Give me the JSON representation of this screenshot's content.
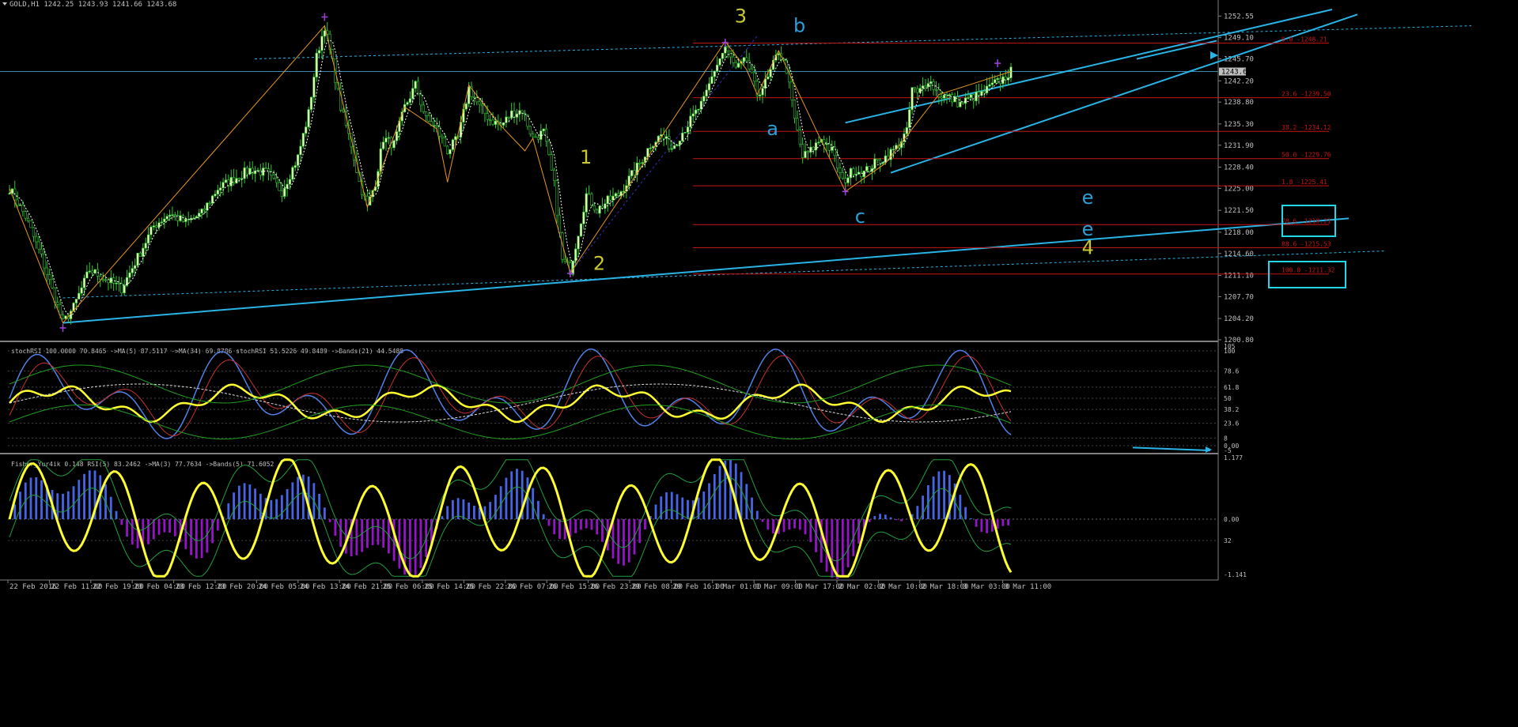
{
  "symbol_header": {
    "symbol": "GOLD,H1",
    "ohlc": "1242.25 1243.93 1241.66 1243.68"
  },
  "chart_data": [
    {
      "type": "candlestick",
      "title": "GOLD,H1",
      "price_axis_ticks": [
        1252.55,
        1249.1,
        1245.7,
        1242.2,
        1238.8,
        1235.3,
        1231.9,
        1228.4,
        1225.0,
        1221.5,
        1218.0,
        1214.6,
        1211.1,
        1207.7,
        1204.2,
        1200.8
      ],
      "ylim": [
        1200.8,
        1253.6
      ],
      "current_price": 1243.68,
      "time_labels": [
        "22 Feb 2016",
        "22 Feb 11:00",
        "22 Feb 19:00",
        "23 Feb 04:00",
        "23 Feb 12:00",
        "23 Feb 20:00",
        "24 Feb 05:00",
        "24 Feb 13:00",
        "24 Feb 21:00",
        "25 Feb 06:00",
        "25 Feb 14:00",
        "25 Feb 22:00",
        "26 Feb 07:00",
        "26 Feb 15:00",
        "26 Feb 23:00",
        "29 Feb 08:00",
        "29 Feb 16:00",
        "1 Mar 01:00",
        "1 Mar 09:00",
        "1 Mar 17:00",
        "2 Mar 02:00",
        "2 Mar 10:00",
        "2 Mar 18:00",
        "3 Mar 03:00",
        "3 Mar 11:00"
      ],
      "price_path": [
        [
          0,
          1225.0
        ],
        [
          6,
          1220.5
        ],
        [
          12,
          1214.0
        ],
        [
          17,
          1207.5
        ],
        [
          20,
          1203.5
        ],
        [
          24,
          1206.0
        ],
        [
          30,
          1212.0
        ],
        [
          36,
          1210.5
        ],
        [
          42,
          1209.0
        ],
        [
          48,
          1214.0
        ],
        [
          54,
          1219.0
        ],
        [
          60,
          1221.0
        ],
        [
          66,
          1219.5
        ],
        [
          72,
          1221.0
        ],
        [
          78,
          1225.0
        ],
        [
          84,
          1226.5
        ],
        [
          90,
          1228.0
        ],
        [
          96,
          1227.5
        ],
        [
          102,
          1224.5
        ],
        [
          108,
          1230.0
        ],
        [
          112,
          1237.0
        ],
        [
          115,
          1246.0
        ],
        [
          118,
          1251.0
        ],
        [
          121,
          1245.0
        ],
        [
          124,
          1238.0
        ],
        [
          128,
          1232.0
        ],
        [
          131,
          1226.0
        ],
        [
          134,
          1222.0
        ],
        [
          137,
          1226.0
        ],
        [
          140,
          1233.0
        ],
        [
          144,
          1232.0
        ],
        [
          148,
          1238.0
        ],
        [
          152,
          1241.5
        ],
        [
          156,
          1236.0
        ],
        [
          160,
          1234.5
        ],
        [
          164,
          1231.0
        ],
        [
          168,
          1233.0
        ],
        [
          172,
          1241.0
        ],
        [
          176,
          1238.0
        ],
        [
          180,
          1236.0
        ],
        [
          184,
          1235.0
        ],
        [
          188,
          1237.0
        ],
        [
          192,
          1237.5
        ],
        [
          196,
          1233.0
        ],
        [
          200,
          1234.0
        ],
        [
          204,
          1225.5
        ],
        [
          207,
          1213.5
        ],
        [
          210,
          1212.0
        ],
        [
          213,
          1218.0
        ],
        [
          216,
          1224.0
        ],
        [
          220,
          1221.5
        ],
        [
          224,
          1223.0
        ],
        [
          228,
          1224.0
        ],
        [
          232,
          1226.5
        ],
        [
          236,
          1229.0
        ],
        [
          240,
          1232.0
        ],
        [
          244,
          1233.5
        ],
        [
          248,
          1231.5
        ],
        [
          252,
          1234.0
        ],
        [
          256,
          1236.5
        ],
        [
          260,
          1239.0
        ],
        [
          264,
          1244.0
        ],
        [
          268,
          1247.5
        ],
        [
          272,
          1244.0
        ],
        [
          276,
          1245.5
        ],
        [
          280,
          1240.0
        ],
        [
          284,
          1242.5
        ],
        [
          288,
          1247.0
        ],
        [
          291,
          1244.0
        ],
        [
          294,
          1236.0
        ],
        [
          297,
          1230.0
        ],
        [
          300,
          1231.0
        ],
        [
          304,
          1233.0
        ],
        [
          308,
          1231.0
        ],
        [
          312,
          1226.0
        ],
        [
          316,
          1228.0
        ],
        [
          320,
          1227.5
        ],
        [
          324,
          1229.0
        ],
        [
          328,
          1230.0
        ],
        [
          332,
          1231.5
        ],
        [
          336,
          1234.0
        ],
        [
          338,
          1241.0
        ],
        [
          340,
          1240.0
        ],
        [
          344,
          1242.5
        ],
        [
          348,
          1240.0
        ],
        [
          352,
          1239.5
        ],
        [
          356,
          1238.5
        ],
        [
          360,
          1239.5
        ],
        [
          364,
          1240.0
        ],
        [
          368,
          1241.5
        ],
        [
          372,
          1242.5
        ],
        [
          375,
          1243.68
        ]
      ],
      "fibonacci_levels": [
        {
          "label": "0.0 -1248.21",
          "price": 1248.21
        },
        {
          "label": "23.6 -1239.50",
          "price": 1239.5
        },
        {
          "label": "38.2 -1234.12",
          "price": 1234.12
        },
        {
          "label": "50.0 -1229.76",
          "price": 1229.76
        },
        {
          "label": "1.8 -1225.41",
          "price": 1225.41
        },
        {
          "label": "78.6 -1219.21",
          "price": 1219.21
        },
        {
          "label": "88.6 -1215.53",
          "price": 1215.53
        },
        {
          "label": "100.0 -1211.32",
          "price": 1211.32
        }
      ],
      "wave_labels": [
        {
          "text": "1",
          "color": "#c8c832",
          "price": 1229.0,
          "bar": 210
        },
        {
          "text": "2",
          "color": "#c8c832",
          "price": 1212.0,
          "bar": 215
        },
        {
          "text": "3",
          "color": "#c8c832",
          "price": 1251.5,
          "bar": 268
        },
        {
          "text": "4",
          "color": "#c8c832",
          "price": 1214.5,
          "bar": 398
        },
        {
          "text": "a",
          "color": "#28a0dc",
          "price": 1233.5,
          "bar": 280
        },
        {
          "text": "b",
          "color": "#28a0dc",
          "price": 1250.0,
          "bar": 290
        },
        {
          "text": "c",
          "color": "#28a0dc",
          "price": 1219.5,
          "bar": 313
        },
        {
          "text": "e",
          "color": "#28a0dc",
          "price": 1222.5,
          "bar": 398
        },
        {
          "text": "e",
          "color": "#28a0dc",
          "price": 1217.5,
          "bar": 398
        }
      ]
    },
    {
      "type": "line",
      "title": "stochRSI 100.0000 70.8465 ->MA(5) 87.5117 ->MA(34) 69.8786 stochRSI 51.5226 49.8489 ->Bands(21) 44.5488",
      "ticks": [
        "105",
        "100",
        "78.6",
        "61.8",
        "50",
        "38.2",
        "23.6",
        "8",
        "0.00",
        "-5"
      ],
      "ylim": [
        -5,
        105
      ]
    },
    {
      "type": "bar",
      "title": "Fisher_Yur4ik 0.148 RSI(5) 83.2462 ->MA(3) 77.7634 ->Bands(5) 71.6052",
      "ticks": [
        "1.177",
        "0.00",
        "32",
        "-1.141"
      ],
      "ylim": [
        -1.141,
        1.177
      ]
    }
  ],
  "colors": {
    "background": "#000000",
    "bull_candle": "#e6ffb4",
    "bear_candle": "#32c832",
    "cyan_lines": "#28b4e6",
    "fib_lines": "#c81414",
    "zigzag": "#e6961e",
    "wave_green": "#c8c832",
    "histo_up": "#4664e6",
    "histo_down": "#9614c8"
  }
}
